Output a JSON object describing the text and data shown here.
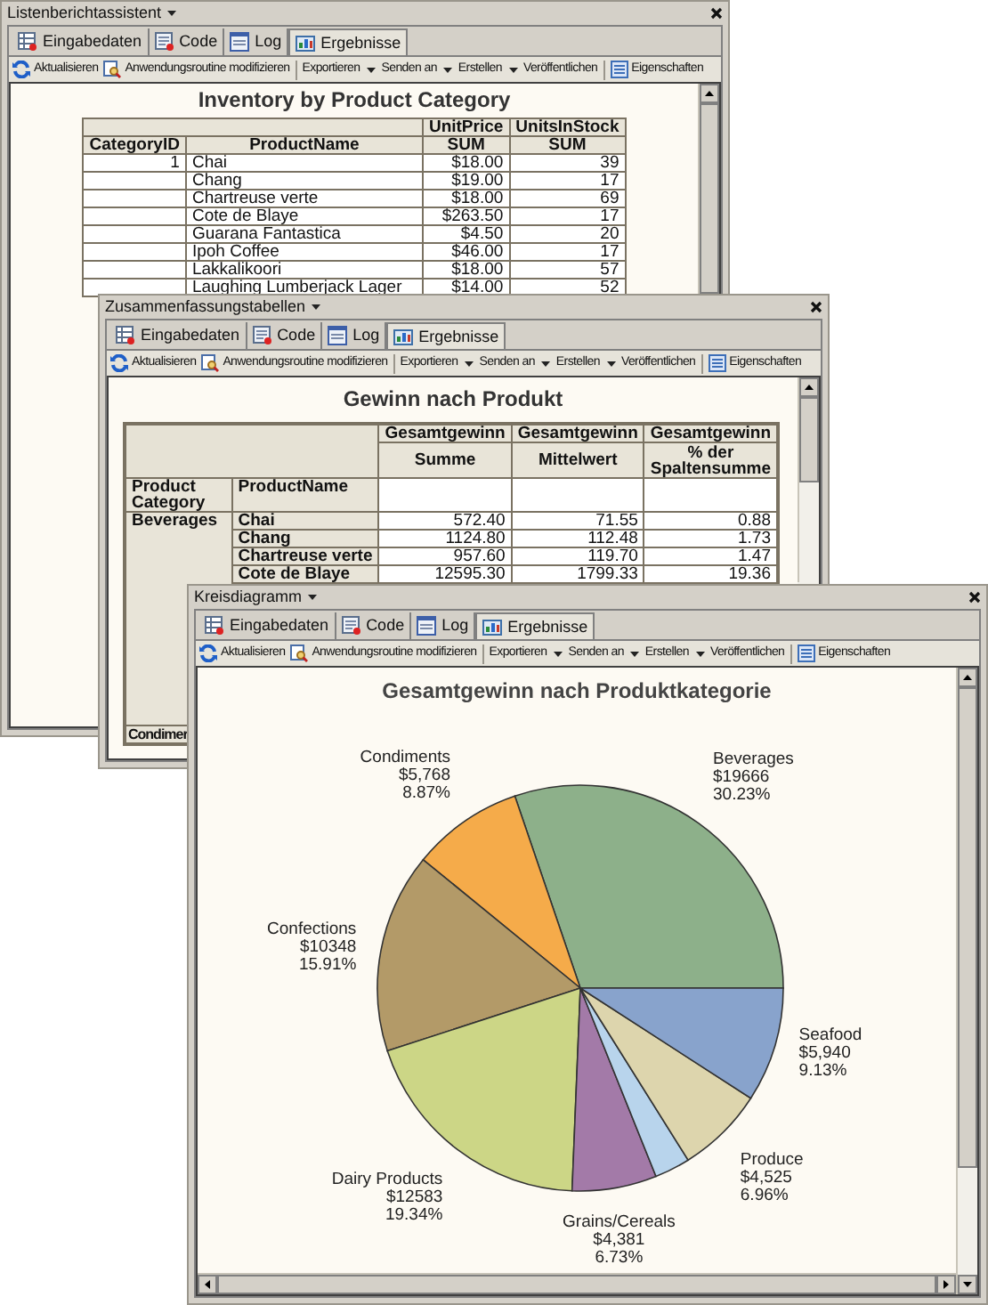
{
  "windows": [
    {
      "title": "Listenberichtassistent",
      "tabs": [
        {
          "label": "Eingabedaten",
          "selected": false
        },
        {
          "label": "Code",
          "selected": false
        },
        {
          "label": "Log",
          "selected": false
        },
        {
          "label": "Ergebnisse",
          "selected": true
        }
      ],
      "toolbar": [
        {
          "label": "Aktualisieren",
          "kind": "icon"
        },
        {
          "label": "Anwendungsroutine modifizieren",
          "kind": "icon"
        },
        {
          "label": "Exportieren",
          "kind": "menu"
        },
        {
          "label": "Senden an",
          "kind": "menu"
        },
        {
          "label": "Erstellen",
          "kind": "menu"
        },
        {
          "label": "Veröffentlichen",
          "kind": "plain"
        },
        {
          "label": "Eigenschaften",
          "kind": "icon"
        }
      ],
      "content": {
        "kind": "list_report",
        "title": "Inventory by Product Category",
        "columns": [
          {
            "name": "CategoryID"
          },
          {
            "name": "ProductName"
          },
          {
            "group": "UnitPrice",
            "name": "SUM"
          },
          {
            "group": "UnitsInStock",
            "name": "SUM"
          }
        ],
        "rows": [
          [
            "1",
            "Chai",
            "$18.00",
            "39"
          ],
          [
            null,
            "Chang",
            "$19.00",
            "17"
          ],
          [
            null,
            "Chartreuse verte",
            "$18.00",
            "69"
          ],
          [
            null,
            "Cote de Blaye",
            "$263.50",
            "17"
          ],
          [
            null,
            "Guarana Fantastica",
            "$4.50",
            "20"
          ],
          [
            null,
            "Ipoh Coffee",
            "$46.00",
            "17"
          ],
          [
            null,
            "Lakkalikoori",
            "$18.00",
            "57"
          ],
          [
            null,
            "Laughing Lumberjack Lager",
            "$14.00",
            "52"
          ]
        ]
      }
    },
    {
      "title": "Zusammenfassungstabellen",
      "tabs": [
        {
          "label": "Eingabedaten",
          "selected": false
        },
        {
          "label": "Code",
          "selected": false
        },
        {
          "label": "Log",
          "selected": false
        },
        {
          "label": "Ergebnisse",
          "selected": true
        }
      ],
      "toolbar": [
        {
          "label": "Aktualisieren",
          "kind": "icon"
        },
        {
          "label": "Anwendungsroutine modifizieren",
          "kind": "icon"
        },
        {
          "label": "Exportieren",
          "kind": "menu"
        },
        {
          "label": "Senden an",
          "kind": "menu"
        },
        {
          "label": "Erstellen",
          "kind": "menu"
        },
        {
          "label": "Veröffentlichen",
          "kind": "plain"
        },
        {
          "label": "Eigenschaften",
          "kind": "icon"
        }
      ],
      "content": {
        "kind": "crosstab",
        "title": "Gewinn nach Produkt",
        "measures": [
          {
            "group": "Gesamtgewinn",
            "name": "Summe"
          },
          {
            "group": "Gesamtgewinn",
            "name": "Mittelwert"
          },
          {
            "group": "Gesamtgewinn",
            "name": "% der Spaltensumme"
          }
        ],
        "row_headers": [
          "Product Category",
          "ProductName"
        ],
        "groups": [
          {
            "category": "Beverages",
            "rows": [
              {
                "product": "Chai",
                "values": [
                  "572.40",
                  "71.55",
                  "0.88"
                ]
              },
              {
                "product": "Chang",
                "values": [
                  "1124.80",
                  "112.48",
                  "1.73"
                ]
              },
              {
                "product": "Chartreuse verte",
                "values": [
                  "957.60",
                  "119.70",
                  "1.47"
                ]
              },
              {
                "product": "Cote de Blaye",
                "values": [
                  "12595.30",
                  "1799.33",
                  "19.36"
                ]
              }
            ]
          },
          {
            "category": "Condimer"
          }
        ]
      }
    },
    {
      "title": "Kreisdiagramm",
      "tabs": [
        {
          "label": "Eingabedaten",
          "selected": false
        },
        {
          "label": "Code",
          "selected": false
        },
        {
          "label": "Log",
          "selected": false
        },
        {
          "label": "Ergebnisse",
          "selected": true
        }
      ],
      "toolbar": [
        {
          "label": "Aktualisieren",
          "kind": "icon"
        },
        {
          "label": "Anwendungsroutine modifizieren",
          "kind": "icon"
        },
        {
          "label": "Exportieren",
          "kind": "menu"
        },
        {
          "label": "Senden an",
          "kind": "menu"
        },
        {
          "label": "Erstellen",
          "kind": "menu"
        },
        {
          "label": "Veröffentlichen",
          "kind": "plain"
        },
        {
          "label": "Eigenschaften",
          "kind": "icon"
        }
      ],
      "content": {
        "kind": "pie",
        "chart_data": {
          "type": "pie",
          "title": "Gesamtgewinn nach Produktkategorie",
          "categories": [
            "Beverages",
            "Condiments",
            "Confections",
            "Dairy Products",
            "Grains/Cereals",
            null,
            "Produce",
            "Seafood"
          ],
          "values": [
            30.23,
            8.87,
            15.91,
            19.34,
            6.73,
            2.83,
            6.96,
            9.13
          ],
          "colors": [
            "#8db08a",
            "#f5ab4a",
            "#b39a68",
            "#ccd686",
            "#a37aa8",
            "#b8d4ec",
            "#ddd5ad",
            "#88a3cc"
          ],
          "value_labels": [
            [
              "$19666",
              "30.23%"
            ],
            [
              "$5,768",
              "8.87%"
            ],
            [
              "$10348",
              "15.91%"
            ],
            [
              "$12583",
              "19.34%"
            ],
            [
              "$4,381",
              "6.73%"
            ],
            null,
            [
              "$4,525",
              "6.96%"
            ],
            [
              "$5,940",
              "9.13%"
            ]
          ]
        }
      }
    }
  ]
}
